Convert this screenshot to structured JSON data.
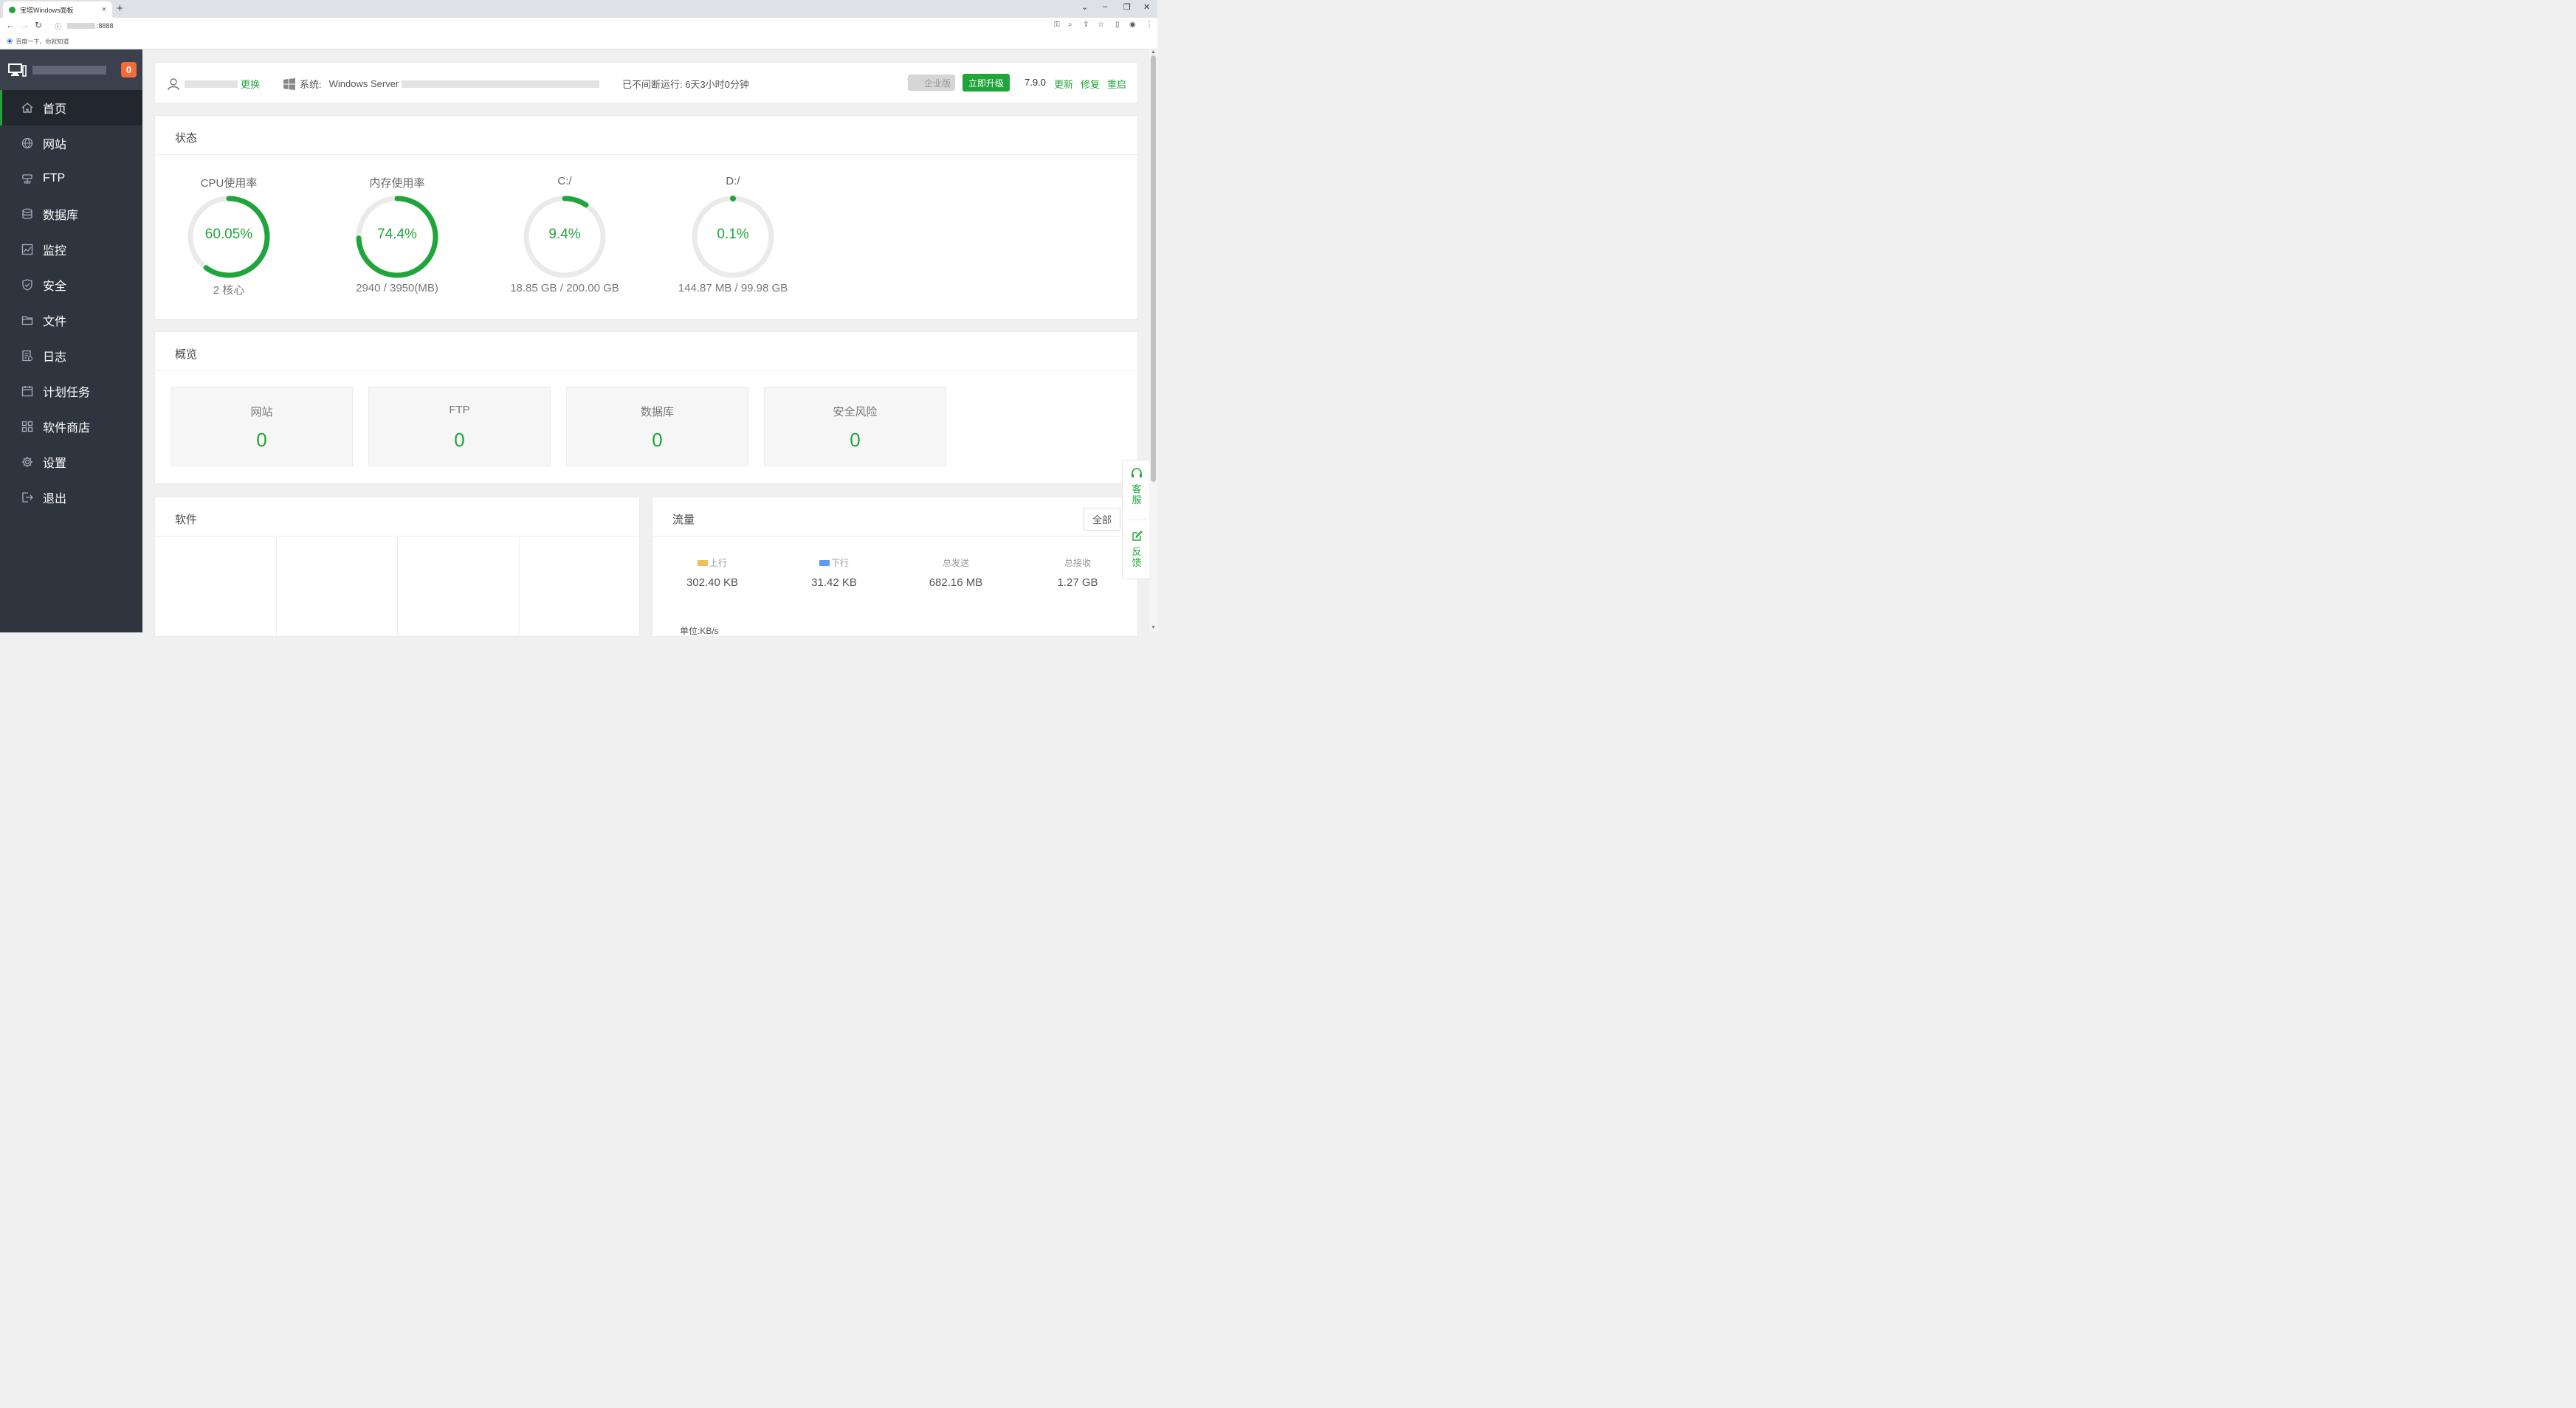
{
  "browser": {
    "tab_title": "宝塔Windows面板",
    "tab_close": "×",
    "new_tab": "+",
    "url": ":8888",
    "bookmark": "百度一下，你就知道",
    "window_controls": [
      "⌄",
      "–",
      "❐",
      "✕"
    ]
  },
  "sidebar": {
    "badge": "0",
    "items": [
      {
        "label": "首页",
        "icon": "home-icon"
      },
      {
        "label": "网站",
        "icon": "globe-icon"
      },
      {
        "label": "FTP",
        "icon": "ftp-icon"
      },
      {
        "label": "数据库",
        "icon": "database-icon"
      },
      {
        "label": "监控",
        "icon": "monitor-chart-icon"
      },
      {
        "label": "安全",
        "icon": "shield-icon"
      },
      {
        "label": "文件",
        "icon": "folder-icon"
      },
      {
        "label": "日志",
        "icon": "log-icon"
      },
      {
        "label": "计划任务",
        "icon": "calendar-icon"
      },
      {
        "label": "软件商店",
        "icon": "apps-icon"
      },
      {
        "label": "设置",
        "icon": "gear-icon"
      },
      {
        "label": "退出",
        "icon": "logout-icon"
      }
    ]
  },
  "topbar": {
    "change_link": "更换",
    "system_label": "系统:",
    "system_value": "Windows Server",
    "uptime": "已不间断运行: 6天3小时0分钟",
    "enterprise_badge": "企业版",
    "upgrade_button": "立即升级",
    "version": "7.9.0",
    "update_link": "更新",
    "repair_link": "修复",
    "restart_link": "重启"
  },
  "status": {
    "title": "状态",
    "gauges": [
      {
        "title": "CPU使用率",
        "value": "60.05%",
        "percent": 60.05,
        "sub": "2 核心"
      },
      {
        "title": "内存使用率",
        "value": "74.4%",
        "percent": 74.4,
        "sub": "2940 / 3950(MB)"
      },
      {
        "title": "C:/",
        "value": "9.4%",
        "percent": 9.4,
        "sub": "18.85 GB / 200.00 GB"
      },
      {
        "title": "D:/",
        "value": "0.1%",
        "percent": 0.1,
        "sub": "144.87 MB / 99.98 GB"
      }
    ]
  },
  "overview": {
    "title": "概览",
    "cards": [
      {
        "label": "网站",
        "value": "0"
      },
      {
        "label": "FTP",
        "value": "0"
      },
      {
        "label": "数据库",
        "value": "0"
      },
      {
        "label": "安全风险",
        "value": "0"
      }
    ]
  },
  "software": {
    "title": "软件"
  },
  "traffic": {
    "title": "流量",
    "filter_button": "全部",
    "items": [
      {
        "label": "上行",
        "value": "302.40 KB",
        "swatch": "#f0bf5d"
      },
      {
        "label": "下行",
        "value": "31.42 KB",
        "swatch": "#5b9bf0"
      },
      {
        "label": "总发送",
        "value": "682.16 MB"
      },
      {
        "label": "总接收",
        "value": "1.27 GB"
      }
    ],
    "unit": "单位:KB/s"
  },
  "float_buttons": {
    "service": "客服",
    "feedback": "反馈"
  },
  "colors": {
    "accent": "#20a53a",
    "sidebar_bg": "#2f353f",
    "badge": "#f26b3a",
    "gauge_track": "#eaeaea"
  }
}
